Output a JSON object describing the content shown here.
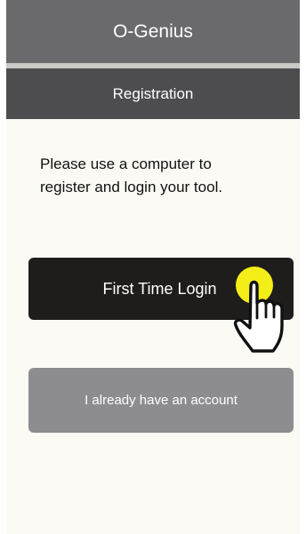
{
  "header": {
    "title": "O-Genius"
  },
  "subheader": {
    "title": "Registration"
  },
  "main": {
    "instruction": "Please use a computer to\nregister and login your tool."
  },
  "buttons": {
    "first_time_login": "First Time Login",
    "existing_account": "I already have an account"
  },
  "colors": {
    "header_bg": "#6a6a6d",
    "divider": "#c9c9c6",
    "subheader_bg": "#4d4d4f",
    "page_bg": "#fbfaf4",
    "primary_button": "#1f1d1c",
    "secondary_button": "#8d8d8f",
    "tap_highlight": "#f4ee18"
  },
  "icons": {
    "tap_hint": "pointing-hand-icon"
  }
}
